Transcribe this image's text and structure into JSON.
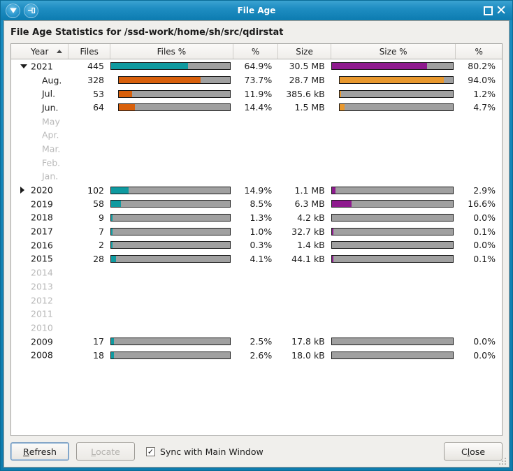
{
  "window": {
    "title": "File Age",
    "menu_icon": "chevron-down-icon",
    "pin_icon": "pin-icon",
    "maximize_icon": "maximize-icon",
    "close_icon": "close-icon"
  },
  "heading": "File Age Statistics for /ssd-work/home/sh/src/qdirstat",
  "colors": {
    "year_files_bar": "#0f9aa0",
    "month_files_bar": "#d8600c",
    "year_size_bar": "#8e1a8e",
    "month_size_bar": "#e8982e",
    "bar_background": "#a0a0a0",
    "accent": "#1283b6"
  },
  "table": {
    "columns": [
      {
        "label": "Year",
        "sorted": true,
        "sort_direction": "ascending"
      },
      {
        "label": "Files",
        "sorted": false
      },
      {
        "label": "Files %",
        "sorted": false
      },
      {
        "label": "%",
        "sorted": false
      },
      {
        "label": "Size",
        "sorted": false
      },
      {
        "label": "Size %",
        "sorted": false
      },
      {
        "label": "%",
        "sorted": false
      }
    ],
    "rows": [
      {
        "label": "2021",
        "level": "year",
        "expander": "open",
        "empty": false,
        "files": "445",
        "files_pct": "64.9%",
        "files_pct_value": 64.9,
        "size": "30.5 MB",
        "size_pct": "80.2%",
        "size_pct_value": 80.2
      },
      {
        "label": "Aug.",
        "level": "month",
        "expander": "none",
        "empty": false,
        "files": "328",
        "files_pct": "73.7%",
        "files_pct_value": 73.7,
        "size": "28.7 MB",
        "size_pct": "94.0%",
        "size_pct_value": 94.0
      },
      {
        "label": "Jul.",
        "level": "month",
        "expander": "none",
        "empty": false,
        "files": "53",
        "files_pct": "11.9%",
        "files_pct_value": 11.9,
        "size": "385.6 kB",
        "size_pct": "1.2%",
        "size_pct_value": 1.2
      },
      {
        "label": "Jun.",
        "level": "month",
        "expander": "none",
        "empty": false,
        "files": "64",
        "files_pct": "14.4%",
        "files_pct_value": 14.4,
        "size": "1.5 MB",
        "size_pct": "4.7%",
        "size_pct_value": 4.7
      },
      {
        "label": "May",
        "level": "month",
        "expander": "none",
        "empty": true
      },
      {
        "label": "Apr.",
        "level": "month",
        "expander": "none",
        "empty": true
      },
      {
        "label": "Mar.",
        "level": "month",
        "expander": "none",
        "empty": true
      },
      {
        "label": "Feb.",
        "level": "month",
        "expander": "none",
        "empty": true
      },
      {
        "label": "Jan.",
        "level": "month",
        "expander": "none",
        "empty": true
      },
      {
        "label": "2020",
        "level": "year",
        "expander": "closed",
        "empty": false,
        "files": "102",
        "files_pct": "14.9%",
        "files_pct_value": 14.9,
        "size": "1.1 MB",
        "size_pct": "2.9%",
        "size_pct_value": 2.9
      },
      {
        "label": "2019",
        "level": "year",
        "expander": "none",
        "empty": false,
        "files": "58",
        "files_pct": "8.5%",
        "files_pct_value": 8.5,
        "size": "6.3 MB",
        "size_pct": "16.6%",
        "size_pct_value": 16.6
      },
      {
        "label": "2018",
        "level": "year",
        "expander": "none",
        "empty": false,
        "files": "9",
        "files_pct": "1.3%",
        "files_pct_value": 1.3,
        "size": "4.2 kB",
        "size_pct": "0.0%",
        "size_pct_value": 0.0
      },
      {
        "label": "2017",
        "level": "year",
        "expander": "none",
        "empty": false,
        "files": "7",
        "files_pct": "1.0%",
        "files_pct_value": 1.0,
        "size": "32.7 kB",
        "size_pct": "0.1%",
        "size_pct_value": 0.1
      },
      {
        "label": "2016",
        "level": "year",
        "expander": "none",
        "empty": false,
        "files": "2",
        "files_pct": "0.3%",
        "files_pct_value": 0.3,
        "size": "1.4 kB",
        "size_pct": "0.0%",
        "size_pct_value": 0.0
      },
      {
        "label": "2015",
        "level": "year",
        "expander": "none",
        "empty": false,
        "files": "28",
        "files_pct": "4.1%",
        "files_pct_value": 4.1,
        "size": "44.1 kB",
        "size_pct": "0.1%",
        "size_pct_value": 0.1
      },
      {
        "label": "2014",
        "level": "year",
        "expander": "none",
        "empty": true
      },
      {
        "label": "2013",
        "level": "year",
        "expander": "none",
        "empty": true
      },
      {
        "label": "2012",
        "level": "year",
        "expander": "none",
        "empty": true
      },
      {
        "label": "2011",
        "level": "year",
        "expander": "none",
        "empty": true
      },
      {
        "label": "2010",
        "level": "year",
        "expander": "none",
        "empty": true
      },
      {
        "label": "2009",
        "level": "year",
        "expander": "none",
        "empty": false,
        "files": "17",
        "files_pct": "2.5%",
        "files_pct_value": 2.5,
        "size": "17.8 kB",
        "size_pct": "0.0%",
        "size_pct_value": 0.0
      },
      {
        "label": "2008",
        "level": "year",
        "expander": "none",
        "empty": false,
        "files": "18",
        "files_pct": "2.6%",
        "files_pct_value": 2.6,
        "size": "18.0 kB",
        "size_pct": "0.0%",
        "size_pct_value": 0.0
      }
    ]
  },
  "footer": {
    "refresh_label": "Refresh",
    "refresh_mnemonic": "R",
    "locate_label": "Locate",
    "locate_mnemonic": "L",
    "locate_disabled": true,
    "sync_label": "Sync with Main Window",
    "sync_mnemonic": "S",
    "sync_checked": true,
    "check_glyph": "✓",
    "close_label": "Close",
    "close_mnemonic": "C"
  }
}
